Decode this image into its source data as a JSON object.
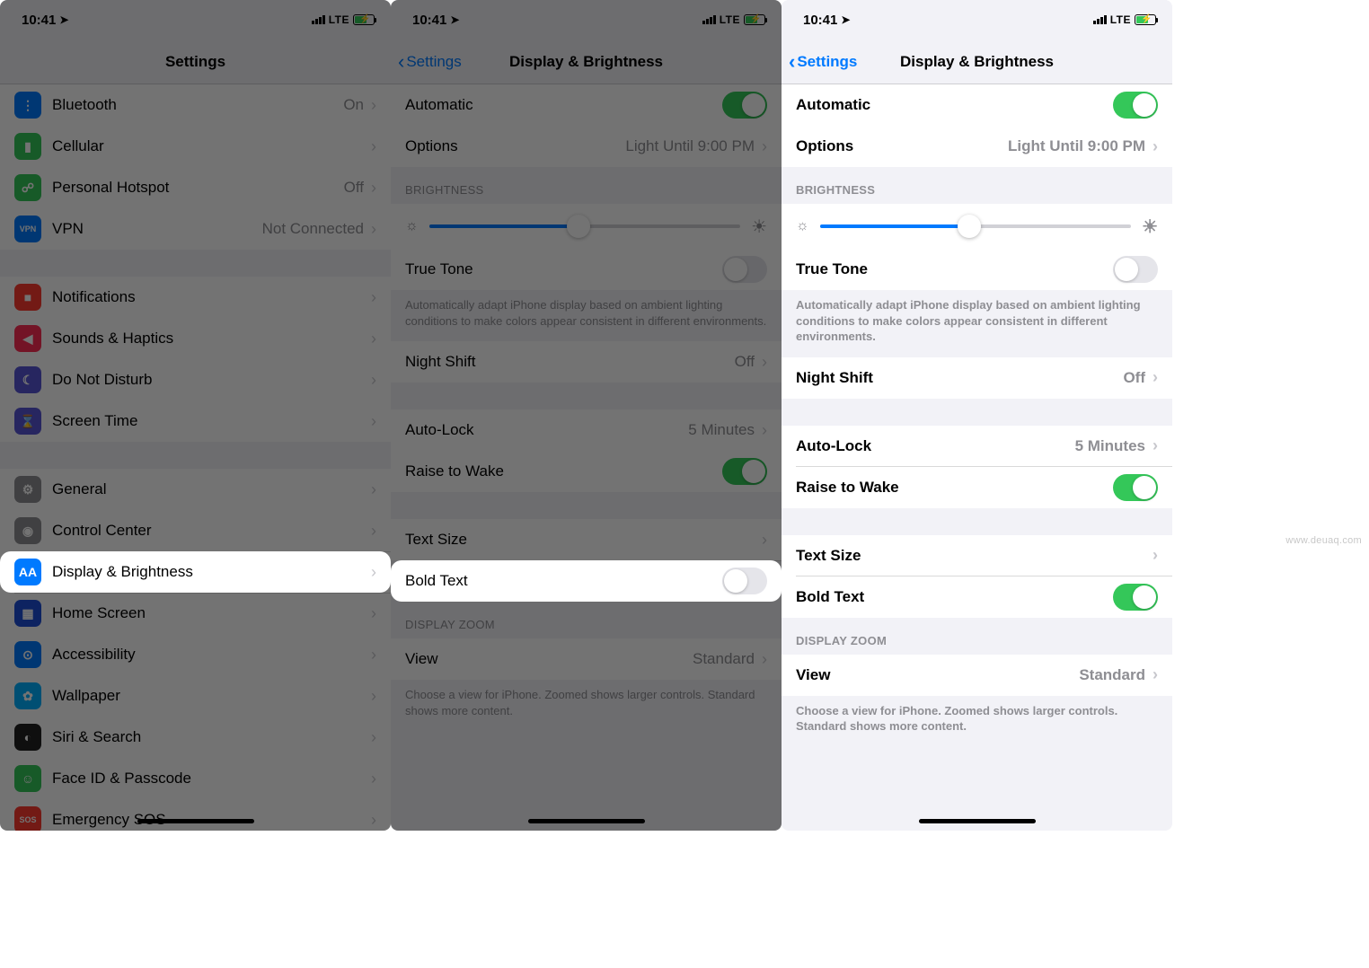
{
  "status": {
    "time": "10:41",
    "network": "LTE"
  },
  "screen1": {
    "title": "Settings",
    "rows": [
      {
        "icon": "c-blue",
        "glyph": "⋮",
        "label": "Bluetooth",
        "value": "On"
      },
      {
        "icon": "c-green",
        "glyph": "▮",
        "label": "Cellular",
        "value": ""
      },
      {
        "icon": "c-green",
        "glyph": "☍",
        "label": "Personal Hotspot",
        "value": "Off"
      },
      {
        "icon": "c-blue",
        "glyph": "VPN",
        "label": "VPN",
        "value": "Not Connected"
      }
    ],
    "rows2": [
      {
        "icon": "c-red",
        "glyph": "■",
        "label": "Notifications"
      },
      {
        "icon": "c-pink",
        "glyph": "◀",
        "label": "Sounds & Haptics"
      },
      {
        "icon": "c-purple",
        "glyph": "☾",
        "label": "Do Not Disturb"
      },
      {
        "icon": "c-purple",
        "glyph": "⌛",
        "label": "Screen Time"
      }
    ],
    "rows3": [
      {
        "icon": "c-gray",
        "glyph": "⚙",
        "label": "General"
      },
      {
        "icon": "c-gray",
        "glyph": "◉",
        "label": "Control Center"
      },
      {
        "icon": "c-blue",
        "glyph": "AA",
        "label": "Display & Brightness"
      },
      {
        "icon": "c-navy",
        "glyph": "▦",
        "label": "Home Screen"
      },
      {
        "icon": "c-blue",
        "glyph": "⊙",
        "label": "Accessibility"
      },
      {
        "icon": "c-cyan",
        "glyph": "✿",
        "label": "Wallpaper"
      },
      {
        "icon": "c-black",
        "glyph": "◐",
        "label": "Siri & Search"
      },
      {
        "icon": "c-green",
        "glyph": "☺",
        "label": "Face ID & Passcode"
      },
      {
        "icon": "c-red",
        "glyph": "SOS",
        "label": "Emergency SOS"
      }
    ]
  },
  "db": {
    "back": "Settings",
    "title": "Display & Brightness",
    "automatic": "Automatic",
    "options": "Options",
    "options_value": "Light Until 9:00 PM",
    "brightness_header": "BRIGHTNESS",
    "truetone": "True Tone",
    "truetone_footer": "Automatically adapt iPhone display based on ambient lighting conditions to make colors appear consistent in different environments.",
    "nightshift": "Night Shift",
    "nightshift_value": "Off",
    "autolock": "Auto-Lock",
    "autolock_value": "5 Minutes",
    "raise": "Raise to Wake",
    "textsize": "Text Size",
    "boldtext": "Bold Text",
    "zoom_header": "DISPLAY ZOOM",
    "view": "View",
    "view_value": "Standard",
    "zoom_footer": "Choose a view for iPhone. Zoomed shows larger controls. Standard shows more content."
  },
  "slider": {
    "pct": 48
  },
  "watermark": "www.deuaq.com"
}
